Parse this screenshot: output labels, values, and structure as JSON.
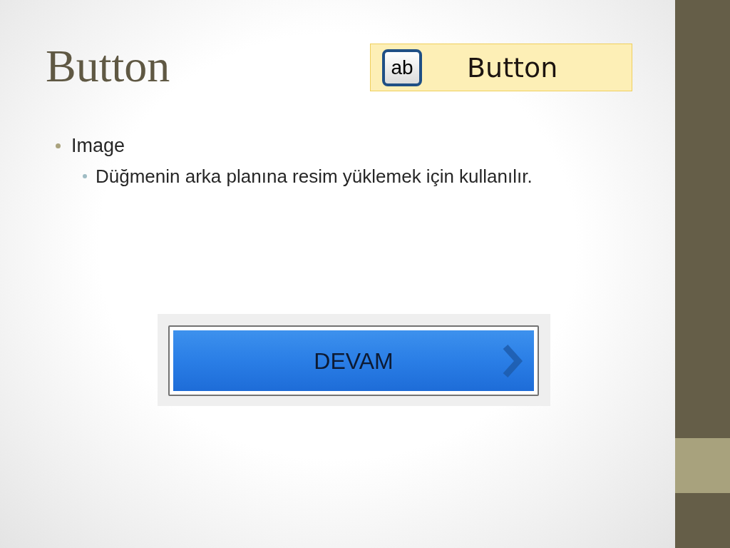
{
  "title": "Button",
  "toolbox_item": {
    "icon_text": "ab",
    "label": "Button"
  },
  "bullets": [
    {
      "text": "Image",
      "children": [
        {
          "text": "Düğmenin arka planına resim yüklemek için kullanılır."
        }
      ]
    }
  ],
  "image_button": {
    "label": "DEVAM"
  }
}
